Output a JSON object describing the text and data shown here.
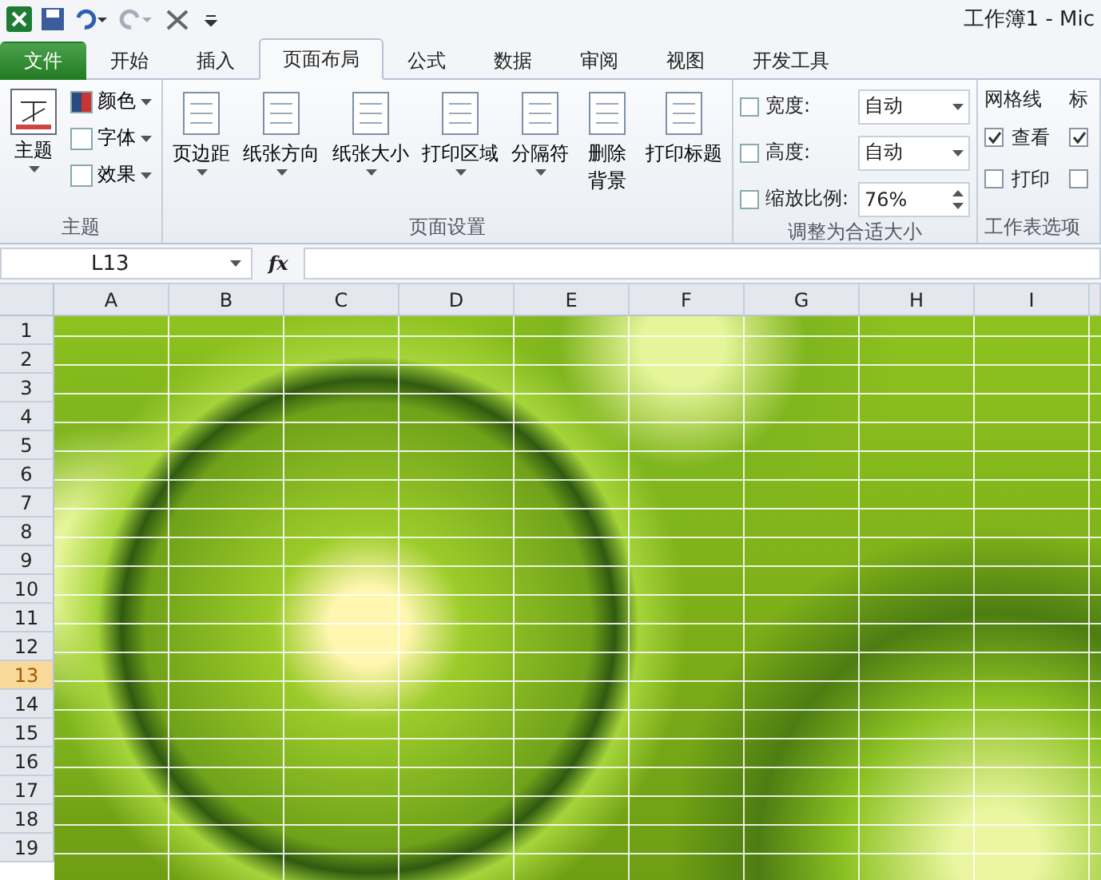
{
  "window": {
    "title": "工作簿1 - Mic"
  },
  "tabs": [
    {
      "label": "文件",
      "kind": "file",
      "selected": false
    },
    {
      "label": "开始",
      "kind": "tab",
      "selected": false
    },
    {
      "label": "插入",
      "kind": "tab",
      "selected": false
    },
    {
      "label": "页面布局",
      "kind": "tab",
      "selected": true
    },
    {
      "label": "公式",
      "kind": "tab",
      "selected": false
    },
    {
      "label": "数据",
      "kind": "tab",
      "selected": false
    },
    {
      "label": "审阅",
      "kind": "tab",
      "selected": false
    },
    {
      "label": "视图",
      "kind": "tab",
      "selected": false
    },
    {
      "label": "开发工具",
      "kind": "tab",
      "selected": false
    }
  ],
  "ribbon": {
    "theme_group": {
      "big_button": "主题",
      "small_buttons": [
        "颜色",
        "字体",
        "效果"
      ],
      "label": "主题"
    },
    "page_setup_group": {
      "buttons": [
        {
          "lines": [
            "页边距"
          ],
          "dropdown": true
        },
        {
          "lines": [
            "纸张方向"
          ],
          "dropdown": true
        },
        {
          "lines": [
            "纸张大小"
          ],
          "dropdown": true
        },
        {
          "lines": [
            "打印区域"
          ],
          "dropdown": true
        },
        {
          "lines": [
            "分隔符"
          ],
          "dropdown": true
        },
        {
          "lines": [
            "删除",
            "背景"
          ],
          "dropdown": false
        },
        {
          "lines": [
            "打印标题"
          ],
          "dropdown": false
        }
      ],
      "label": "页面设置"
    },
    "scale_group": {
      "rows": [
        {
          "label": "宽度:",
          "value": "自动",
          "kind": "dropdown"
        },
        {
          "label": "高度:",
          "value": "自动",
          "kind": "dropdown"
        },
        {
          "label": "缩放比例:",
          "value": "76%",
          "kind": "spinner"
        }
      ],
      "label": "调整为合适大小"
    },
    "sheet_options_group": {
      "columns": [
        {
          "heading": "网格线",
          "view": {
            "label": "查看",
            "checked": true
          },
          "print": {
            "label": "打印",
            "checked": false
          }
        },
        {
          "heading": "标",
          "view": {
            "checked": true
          },
          "print": {
            "checked": false
          }
        }
      ],
      "label": "工作表选项"
    }
  },
  "formula_bar": {
    "name_box": "L13",
    "fx": "fx"
  },
  "sheet": {
    "columns": [
      "A",
      "B",
      "C",
      "D",
      "E",
      "F",
      "G",
      "H",
      "I"
    ],
    "rows": [
      {
        "label": "1",
        "selected": false
      },
      {
        "label": "2",
        "selected": false
      },
      {
        "label": "3",
        "selected": false
      },
      {
        "label": "4",
        "selected": false
      },
      {
        "label": "5",
        "selected": false
      },
      {
        "label": "6",
        "selected": false
      },
      {
        "label": "7",
        "selected": false
      },
      {
        "label": "8",
        "selected": false
      },
      {
        "label": "9",
        "selected": false
      },
      {
        "label": "10",
        "selected": false
      },
      {
        "label": "11",
        "selected": false
      },
      {
        "label": "12",
        "selected": false
      },
      {
        "label": "13",
        "selected": true
      },
      {
        "label": "14",
        "selected": false
      },
      {
        "label": "15",
        "selected": false
      },
      {
        "label": "16",
        "selected": false
      },
      {
        "label": "17",
        "selected": false
      },
      {
        "label": "18",
        "selected": false
      },
      {
        "label": "19",
        "selected": false
      }
    ]
  }
}
